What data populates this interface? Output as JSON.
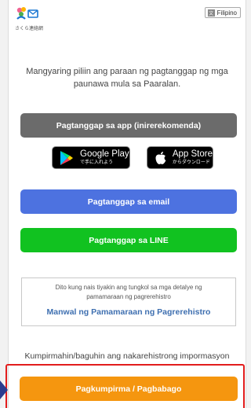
{
  "header": {
    "logo_text": "さくら連絡網",
    "language_label": "Filipino",
    "language_icon": "translate-icon"
  },
  "intro": {
    "line1": "Mangyaring piliin ang paraan ng pagtanggap ng mga",
    "line2": "paunawa mula sa Paaralan."
  },
  "buttons": {
    "app": "Pagtanggap sa app (inirerekomenda)",
    "email": "Pagtanggap sa email",
    "line": "Pagtanggap sa LINE",
    "confirm": "Pagkumpirma / Pagbabago"
  },
  "badges": {
    "google_big": "Google Play",
    "google_small": "で手に入れよう",
    "apple_big": "App Store",
    "apple_small": "からダウンロード"
  },
  "info": {
    "line1": "Dito kung nais tiyakin ang tungkol sa mga detalye ng",
    "line2": "pamamaraan ng pagrerehistro",
    "link": "Manwal ng Pamamaraan ng Pagrerehistro"
  },
  "confirm_label": "Kumpirmahin/baguhin ang nakarehistrong impormasyon",
  "colors": {
    "app_button": "#6b6b6b",
    "email_button": "#4d72e0",
    "line_button": "#11c220",
    "confirm_button": "#f5960f",
    "link": "#3e6fb0",
    "highlight": "#e21d1d"
  }
}
